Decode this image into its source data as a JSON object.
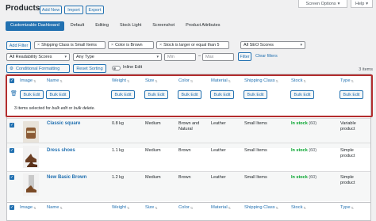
{
  "header": {
    "title": "Products",
    "add_new": "Add New",
    "import": "Import",
    "export": "Export",
    "screen_options": "Screen Options",
    "help": "Help"
  },
  "tabs": [
    {
      "label": "Customizable Dashboard",
      "active": true
    },
    {
      "label": "Default"
    },
    {
      "label": "Editing"
    },
    {
      "label": "Stock Light"
    },
    {
      "label": "Screenshot"
    },
    {
      "label": "Product Attributes"
    }
  ],
  "filters": {
    "add_filter": "Add Filter",
    "chips": [
      "Shipping Class is Small Items",
      "Color is Brown",
      "Stock is larger or equal than 5"
    ],
    "seo": "All SEO Scores",
    "readability": "All Readability Scores",
    "type": "Any Type",
    "min_placeholder": "Min",
    "max_placeholder": "Max",
    "filter_btn": "Filter",
    "clear": "Clear filters",
    "conditional": "Conditional Formatting",
    "reset": "Reset Sorting",
    "inline": "Inline Edit",
    "count": "3 items"
  },
  "columns": [
    "Image",
    "Name",
    "Weight",
    "Size",
    "Color",
    "Material",
    "Shipping Class",
    "Stock",
    "Type"
  ],
  "bulk_label": "Bulk Edit",
  "note": {
    "prefix": "3 items selected for ",
    "a": "bulk edit",
    "mid": " or ",
    "b": "bulk delete",
    "end": "."
  },
  "rows": [
    {
      "name": "Classic square",
      "weight": "0.8 kg",
      "size": "Medium",
      "color": "Brown and Natural",
      "material": "Leather",
      "shipping": "Small Items",
      "stock": "In stock",
      "stock_n": "(60)",
      "type": "Variable product"
    },
    {
      "name": "Dress shoes",
      "weight": "1.1 kg",
      "size": "Medium",
      "color": "Brown",
      "material": "Leather",
      "shipping": "Small Items",
      "stock": "In stock",
      "stock_n": "(60)",
      "type": "Simple product"
    },
    {
      "name": "New Basic Brown",
      "weight": "1.2 kg",
      "size": "Medium",
      "color": "Brown",
      "material": "Leather",
      "shipping": "Small Items",
      "stock": "In stock",
      "stock_n": "(60)",
      "type": "Simple product"
    }
  ],
  "colors": {
    "accent": "#2271b1",
    "highlight": "#b32d2e",
    "instock": "#00a32a"
  }
}
